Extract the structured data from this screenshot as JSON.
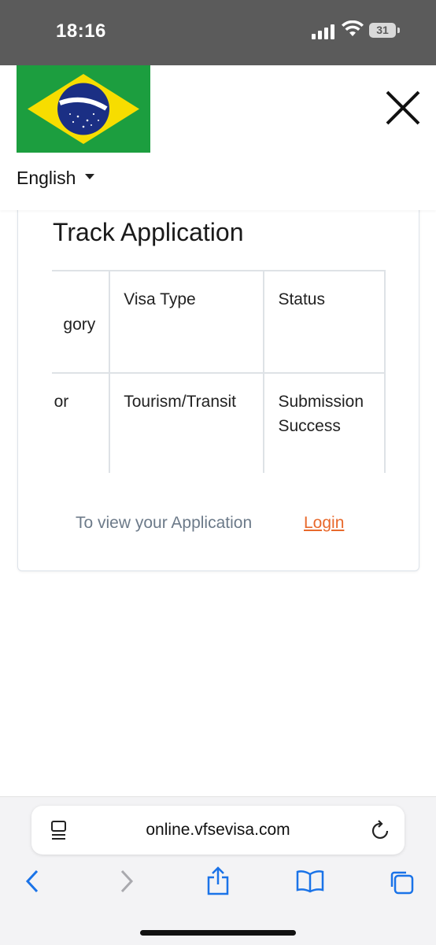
{
  "status_bar": {
    "time": "18:16",
    "battery": "31"
  },
  "header": {
    "language": "English"
  },
  "card": {
    "title": "Track Application",
    "table": {
      "headers": [
        "gory",
        "Visa Type",
        "Status"
      ],
      "row": [
        "or",
        "Tourism/Transit",
        "Submission Success"
      ]
    },
    "footer_text": "To view your Application",
    "login_label": "Login"
  },
  "browser": {
    "url": "online.vfsevisa.com"
  },
  "colors": {
    "accent": "#e8692c",
    "link_nav": "#1a73e8",
    "flag_green": "#1c9e3f",
    "flag_yellow": "#f7dd00",
    "flag_blue": "#1b2f84"
  }
}
